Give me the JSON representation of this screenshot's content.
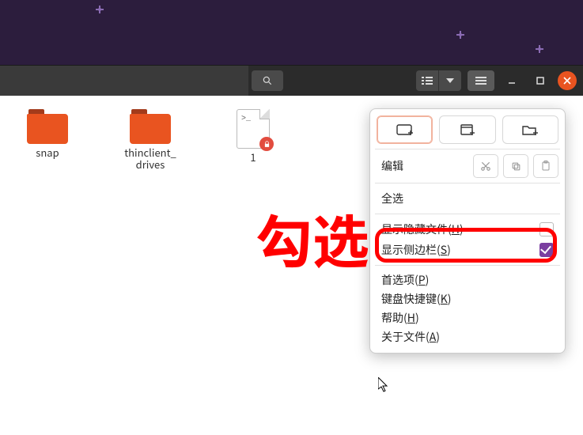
{
  "files": [
    {
      "label": "snap"
    },
    {
      "label": "thinclient_\ndrives"
    },
    {
      "label": "1"
    }
  ],
  "menu": {
    "edit_label": "编辑",
    "select_all": "全选",
    "show_hidden_pre": "显示隐藏文件(",
    "show_hidden_mn": "H",
    "show_hidden_post": ")",
    "show_sidebar_pre": "显示侧边栏(",
    "show_sidebar_mn": "S",
    "show_sidebar_post": ")",
    "prefs_pre": "首选项(",
    "prefs_mn": "P",
    "prefs_post": ")",
    "kb_pre": "键盘快捷键(",
    "kb_mn": "K",
    "kb_post": ")",
    "help_pre": "帮助(",
    "help_mn": "H",
    "help_post": ")",
    "about_pre": "关于文件(",
    "about_mn": "A",
    "about_post": ")",
    "hidden_checked": false,
    "sidebar_checked": true
  },
  "annotation": "勾选"
}
